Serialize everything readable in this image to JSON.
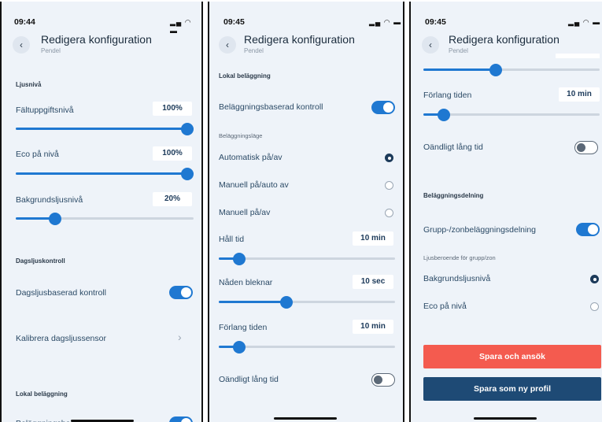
{
  "colors": {
    "accent": "#1f78d1",
    "danger": "#f45b4f",
    "primary_dark": "#1e4a75"
  },
  "screens": [
    {
      "time": "09:44",
      "status_icons": "signal-wifi-battery",
      "header": {
        "title": "Redigera konfiguration",
        "subtitle": "Pendel"
      },
      "section_light": "Ljusnivå",
      "task_level": {
        "label": "Fältuppgiftsnivå",
        "value": "100%",
        "level": 1.0
      },
      "eco_level": {
        "label": "Eco på nivå",
        "value": "100%",
        "level": 1.0
      },
      "bg_level": {
        "label": "Bakgrundsljusnivå",
        "value": "20%",
        "level": 0.2
      },
      "section_daylight": "Dagsljuskontroll",
      "daylight_control": {
        "label": "Dagsljusbaserad kontroll",
        "on": true
      },
      "calibrate": {
        "label": "Kalibrera dagsljussensor"
      },
      "section_occupancy": "Lokal beläggning"
    },
    {
      "time": "09:45",
      "status_icons": "signal-wifi-battery",
      "header": {
        "title": "Redigera konfiguration",
        "subtitle": "Pendel"
      },
      "section_occupancy": "Lokal beläggning",
      "occupancy_control": {
        "label": "Beläggningsbaserad kontroll",
        "on": true
      },
      "mode_label": "Beläggningsläge",
      "modes": [
        {
          "label": "Automatisk på/av",
          "selected": true
        },
        {
          "label": "Manuell på/auto av",
          "selected": false
        },
        {
          "label": "Manuell på/av",
          "selected": false
        }
      ],
      "hold_time": {
        "label": "Håll tid",
        "value": "10 min",
        "level": 0.12
      },
      "fade": {
        "label": "Nåden bleknar",
        "value": "10 sec",
        "level": 0.38
      },
      "extend": {
        "label": "Förlang tiden",
        "value": "10 min",
        "level": 0.12
      },
      "infinite": {
        "label": "Oändligt lång tid",
        "on": false
      }
    },
    {
      "time": "09:45",
      "status_icons": "signal-wifi-battery",
      "header": {
        "title": "Redigera konfiguration",
        "subtitle": "Pendel"
      },
      "top_slider_level": 0.4,
      "extend": {
        "label": "Förlang tiden",
        "value": "10 min",
        "level": 0.12
      },
      "infinite": {
        "label": "Oändligt lång tid",
        "on": false
      },
      "section_sharing": "Beläggningsdelning",
      "group_sharing": {
        "label": "Grupp-/zonbeläggningsdelning",
        "on": true
      },
      "light_label": "Ljusberoende för grupp/zon",
      "options": [
        {
          "label": "Bakgrundsljusnivå",
          "selected": true
        },
        {
          "label": "Eco på nivå",
          "selected": false
        }
      ],
      "save_apply": "Spara och ansök",
      "save_profile": "Spara som ny profil"
    }
  ]
}
